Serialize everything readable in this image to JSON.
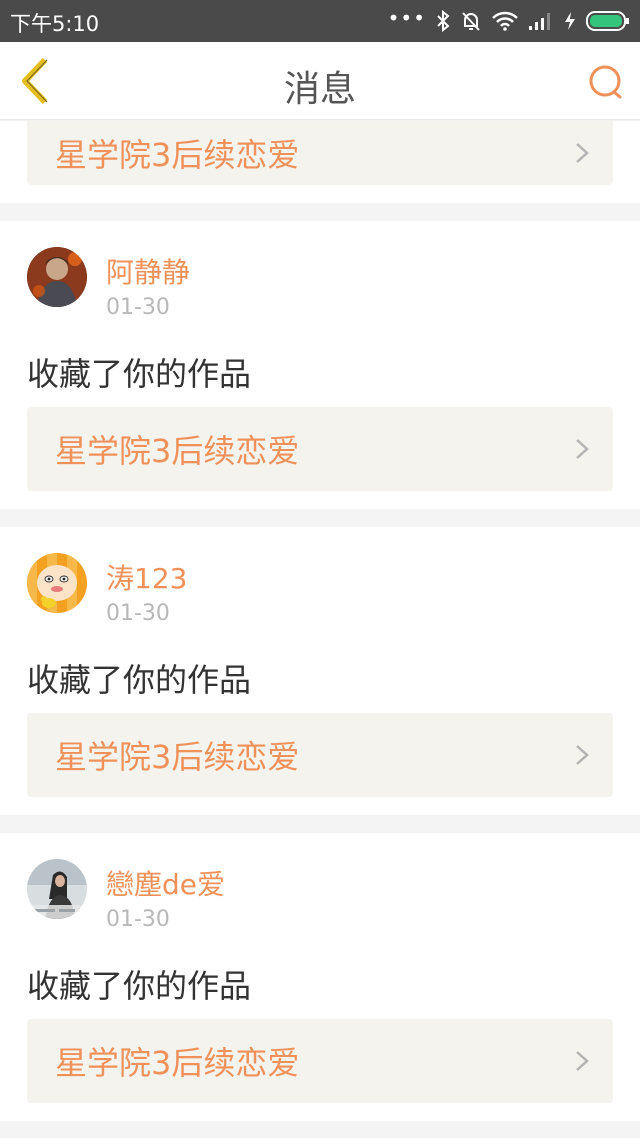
{
  "status_bar": {
    "time": "下午5:10",
    "icons": [
      "more-dots-icon",
      "bluetooth-icon",
      "mute-bell-icon",
      "wifi-icon",
      "signal-icon",
      "charging-icon",
      "battery-icon"
    ]
  },
  "nav": {
    "back_icon": "chevron-left-icon",
    "title": "消息",
    "search_icon": "search-icon",
    "accent_color": "#f0915a"
  },
  "top_partial": {
    "work_title": "星学院3后续恋爱"
  },
  "messages": [
    {
      "user": "阿静静",
      "date": "01-30",
      "action": "收藏了你的作品",
      "work_title": "星学院3后续恋爱",
      "avatar": "avatar-warrior"
    },
    {
      "user": "涛123",
      "date": "01-30",
      "action": "收藏了你的作品",
      "work_title": "星学院3后续恋爱",
      "avatar": "avatar-cartoon"
    },
    {
      "user": "戀塵de爱",
      "date": "01-30",
      "action": "收藏了你的作品",
      "work_title": "星学院3后续恋爱",
      "avatar": "avatar-photo"
    }
  ]
}
